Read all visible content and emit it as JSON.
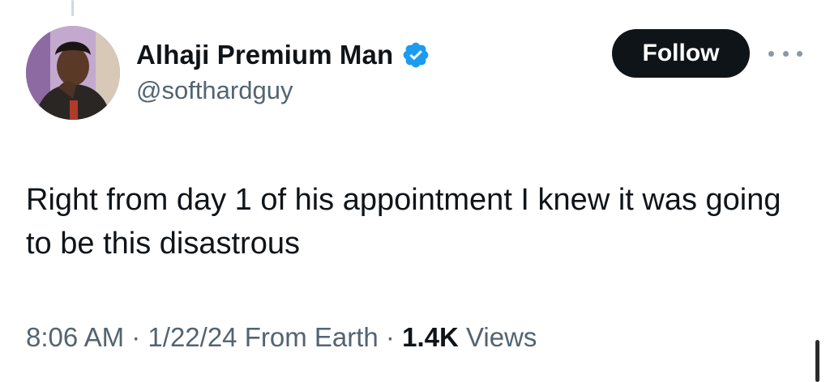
{
  "author": {
    "display_name": "Alhaji Premium Man",
    "handle": "@softhardguy",
    "verified": true
  },
  "actions": {
    "follow_label": "Follow",
    "more_icon": "more-horizontal-icon"
  },
  "tweet": {
    "text": "Right from day 1 of his appointment I knew it was going to be this disastrous"
  },
  "meta": {
    "time": "8:06 AM",
    "date": "1/22/24",
    "source": "From Earth",
    "views_count": "1.4K",
    "views_label": "Views",
    "separator": "·"
  },
  "colors": {
    "verified_badge": "#1d9bf0",
    "follow_button_bg": "#0f1419",
    "secondary_text": "#536471"
  }
}
